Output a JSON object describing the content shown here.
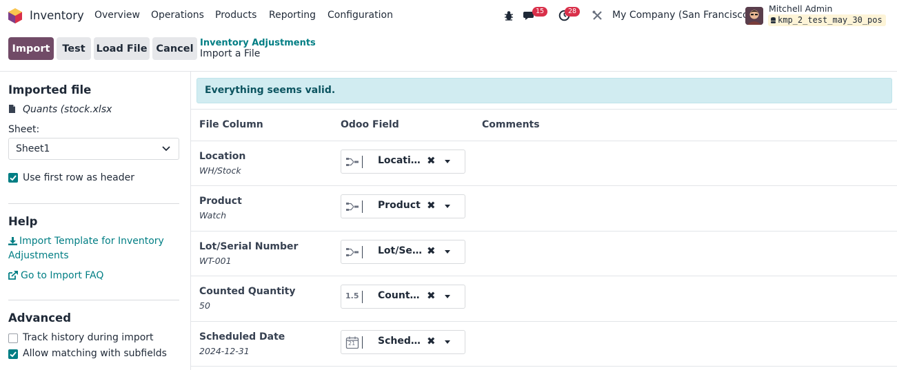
{
  "navbar": {
    "app_name": "Inventory",
    "menus": [
      "Overview",
      "Operations",
      "Products",
      "Reporting",
      "Configuration"
    ],
    "messages_badge": "15",
    "activities_badge": "28",
    "company": "My Company (San Francisco)",
    "user_name": "Mitchell Admin",
    "database": "kmp_2_test_may_30_pos"
  },
  "control_panel": {
    "import_label": "Import",
    "test_label": "Test",
    "load_file_label": "Load File",
    "cancel_label": "Cancel",
    "breadcrumb_parent": "Inventory Adjustments",
    "breadcrumb_current": "Import a File"
  },
  "sidebar": {
    "imported_file_heading": "Imported file",
    "file_name": "Quants (stock.xlsx",
    "sheet_label": "Sheet:",
    "sheet_value": "Sheet1",
    "first_row_header_label": "Use first row as header",
    "first_row_header_checked": true,
    "help_heading": "Help",
    "template_link": "Import Template for Inventory Adjustments",
    "template_link_line1": "Import Template for Inventory",
    "template_link_line2": "Adjustments",
    "faq_link": "Go to Import FAQ",
    "advanced_heading": "Advanced",
    "track_history_label": "Track history during import",
    "track_history_checked": false,
    "allow_matching_label": "Allow matching with subfields",
    "allow_matching_checked": true
  },
  "main": {
    "alert": "Everything seems valid.",
    "columns": {
      "file_column": "File Column",
      "odoo_field": "Odoo Field",
      "comments": "Comments"
    },
    "rows": [
      {
        "column": "Location",
        "sample": "WH/Stock",
        "field": "Location",
        "icon": "relation-icon"
      },
      {
        "column": "Product",
        "sample": "Watch",
        "field": "Product",
        "icon": "relation-icon"
      },
      {
        "column": "Lot/Serial Number",
        "sample": "WT-001",
        "field": "Lot/Serial Number",
        "icon": "relation-icon"
      },
      {
        "column": "Counted Quantity",
        "sample": "50",
        "field": "Counted Quantity",
        "icon": "float-icon",
        "icon_text": "1.5"
      },
      {
        "column": "Scheduled Date",
        "sample": "2024-12-31",
        "field": "Scheduled Date",
        "icon": "calendar-icon",
        "icon_text": "21"
      }
    ]
  },
  "colors": {
    "primary": "#714b67",
    "link": "#017e84",
    "alert_bg": "#d1ecf1",
    "badge": "#d9304a"
  }
}
